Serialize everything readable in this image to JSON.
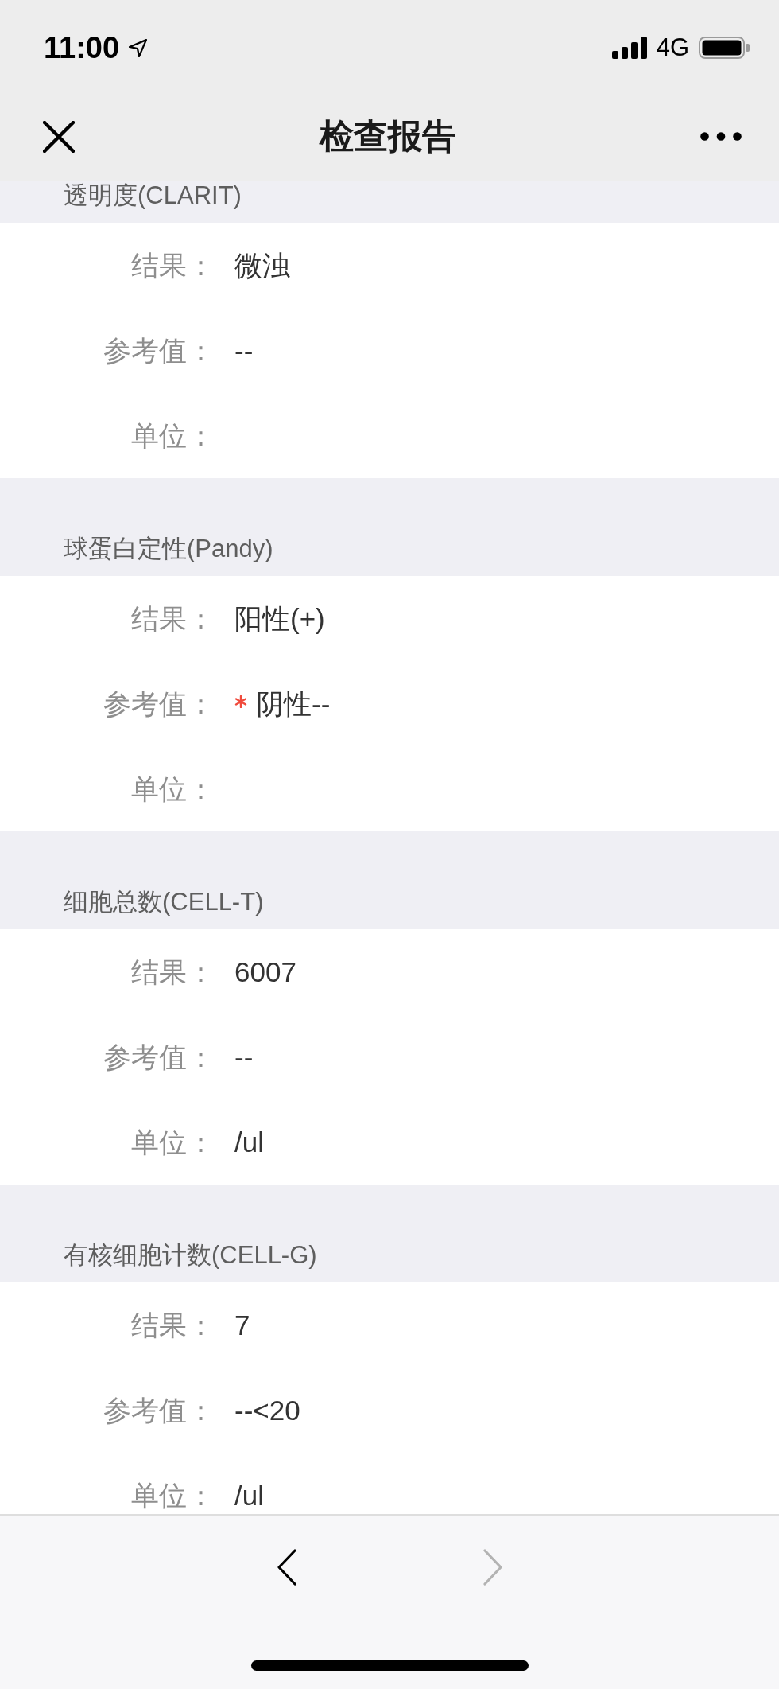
{
  "status_bar": {
    "time": "11:00",
    "network": "4G"
  },
  "nav_bar": {
    "title": "检查报告"
  },
  "sections": [
    {
      "title": "透明度(CLARIT)",
      "rows": [
        {
          "label": "结果：",
          "value": "微浊",
          "abnormal": false
        },
        {
          "label": "参考值：",
          "value": "--",
          "abnormal": false
        },
        {
          "label": "单位：",
          "abnormal": false
        }
      ]
    },
    {
      "title": "球蛋白定性(Pandy)",
      "rows": [
        {
          "label": "结果：",
          "value": "阳性(+)",
          "abnormal": false
        },
        {
          "label": "参考值：",
          "value": "阴性--",
          "abnormal": true
        },
        {
          "label": "单位：",
          "abnormal": false
        }
      ]
    },
    {
      "title": "细胞总数(CELL-T)",
      "rows": [
        {
          "label": "结果：",
          "value": "6007",
          "abnormal": false
        },
        {
          "label": "参考值：",
          "value": "--",
          "abnormal": false
        },
        {
          "label": "单位：",
          "value": "/ul",
          "abnormal": false
        }
      ]
    },
    {
      "title": "有核细胞计数(CELL-G)",
      "rows": [
        {
          "label": "结果：",
          "value": "7",
          "abnormal": false
        },
        {
          "label": "参考值：",
          "value": "--<20",
          "abnormal": false
        },
        {
          "label": "单位：",
          "value": "/ul",
          "abnormal": false
        }
      ]
    }
  ],
  "toolbar": {
    "back": {
      "disabled": false
    },
    "forward": {
      "disabled": true
    }
  }
}
